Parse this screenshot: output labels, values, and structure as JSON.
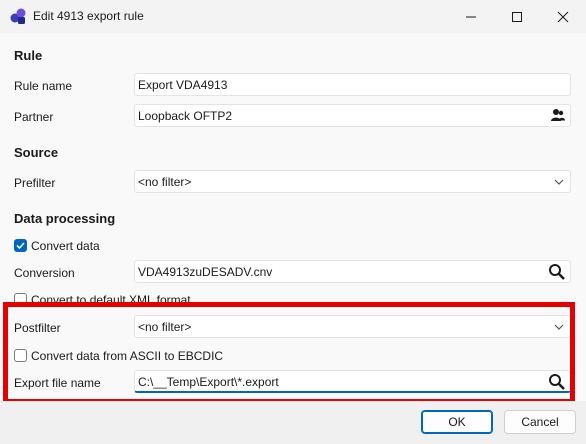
{
  "window": {
    "title": "Edit 4913 export rule",
    "accent": "#0067c0",
    "highlight_color": "#e60000"
  },
  "sections": {
    "rule": "Rule",
    "source": "Source",
    "processing": "Data processing"
  },
  "rule": {
    "name_label": "Rule name",
    "name_value": "Export VDA4913",
    "partner_label": "Partner",
    "partner_value": "Loopback OFTP2",
    "partner_icon": "user-picker-icon"
  },
  "source": {
    "prefilter_label": "Prefilter",
    "prefilter_value": "<no filter>"
  },
  "processing": {
    "convert_data_label": "Convert data",
    "convert_data_checked": true,
    "conversion_label": "Conversion",
    "conversion_value": "VDA4913zuDESADV.cnv",
    "xml_label": "Convert to default XML format",
    "xml_checked": false,
    "postfilter_label": "Postfilter",
    "postfilter_value": "<no filter>",
    "ebcdic_label": "Convert data from ASCII to EBCDIC",
    "ebcdic_checked": false,
    "export_label": "Export file name",
    "export_value": "C:\\__Temp\\Export\\*.export"
  },
  "buttons": {
    "ok": "OK",
    "cancel": "Cancel"
  }
}
